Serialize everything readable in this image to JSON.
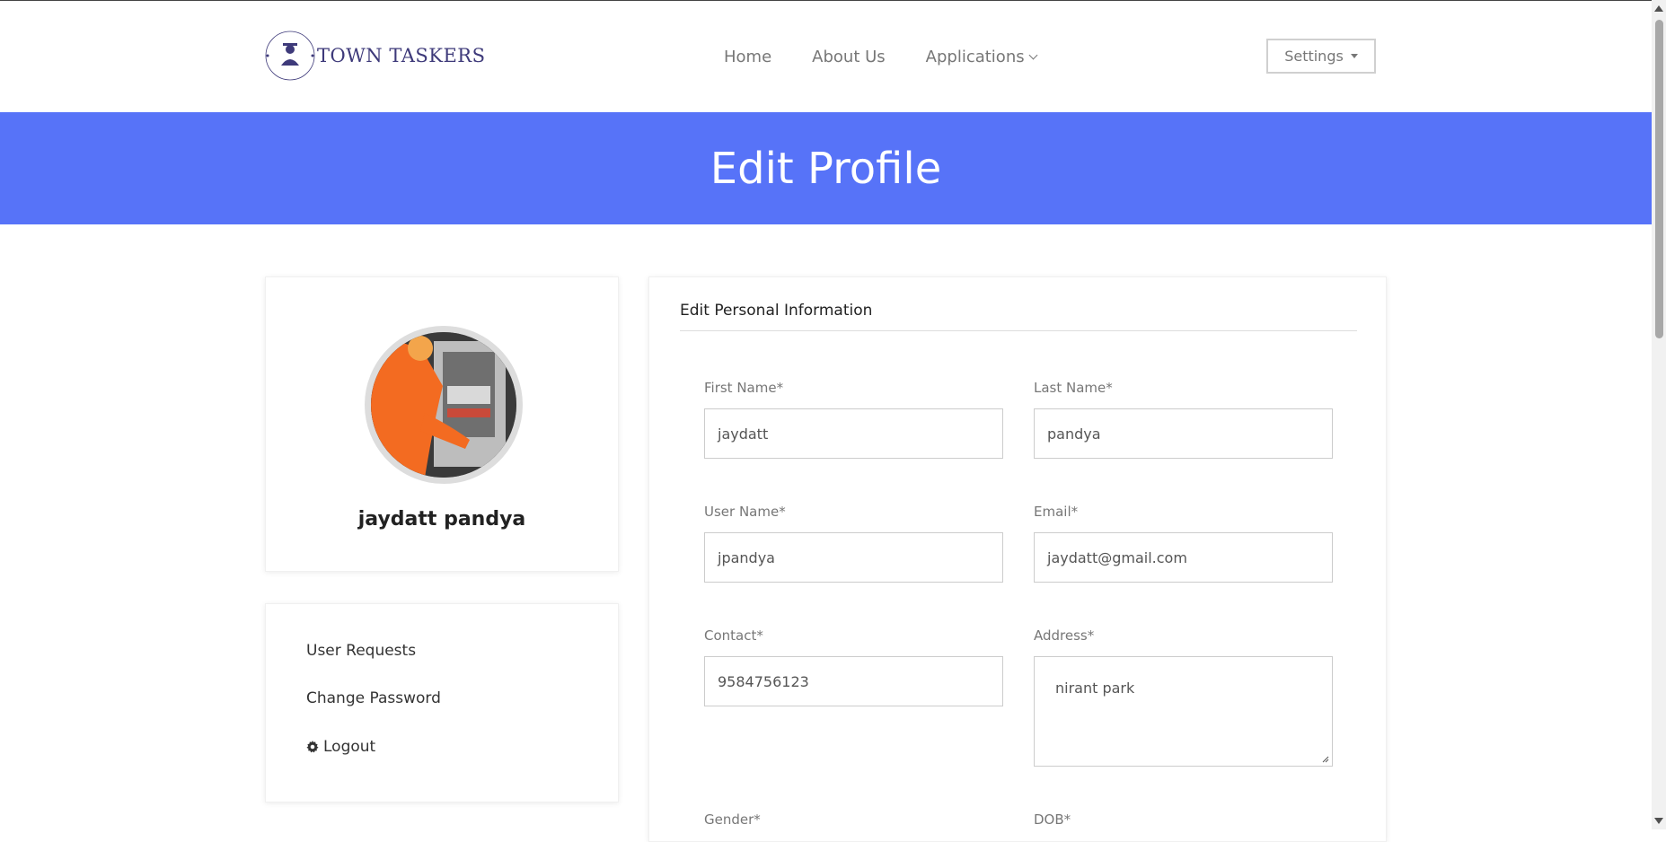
{
  "brand": {
    "name": "TOWN TASKERS",
    "badge_text": "TOWN TASKERS"
  },
  "nav": {
    "items": [
      "Home",
      "About Us",
      "Applications"
    ],
    "settings_label": "Settings"
  },
  "banner": {
    "title": "Edit Profile",
    "color": "#5773f8"
  },
  "profile": {
    "name": "jaydatt pandya"
  },
  "menu": {
    "items": [
      "User Requests",
      "Change Password",
      "Logout"
    ]
  },
  "form": {
    "title": "Edit Personal Information",
    "fields": {
      "first_name": {
        "label": "First Name*",
        "value": "jaydatt"
      },
      "last_name": {
        "label": "Last Name*",
        "value": "pandya"
      },
      "user_name": {
        "label": "User Name*",
        "value": "jpandya"
      },
      "email": {
        "label": "Email*",
        "value": "jaydatt@gmail.com"
      },
      "contact": {
        "label": "Contact*",
        "value": "9584756123"
      },
      "address": {
        "label": "Address*",
        "value": "nirant park"
      },
      "gender": {
        "label": "Gender*"
      },
      "dob": {
        "label": "DOB*"
      }
    }
  }
}
